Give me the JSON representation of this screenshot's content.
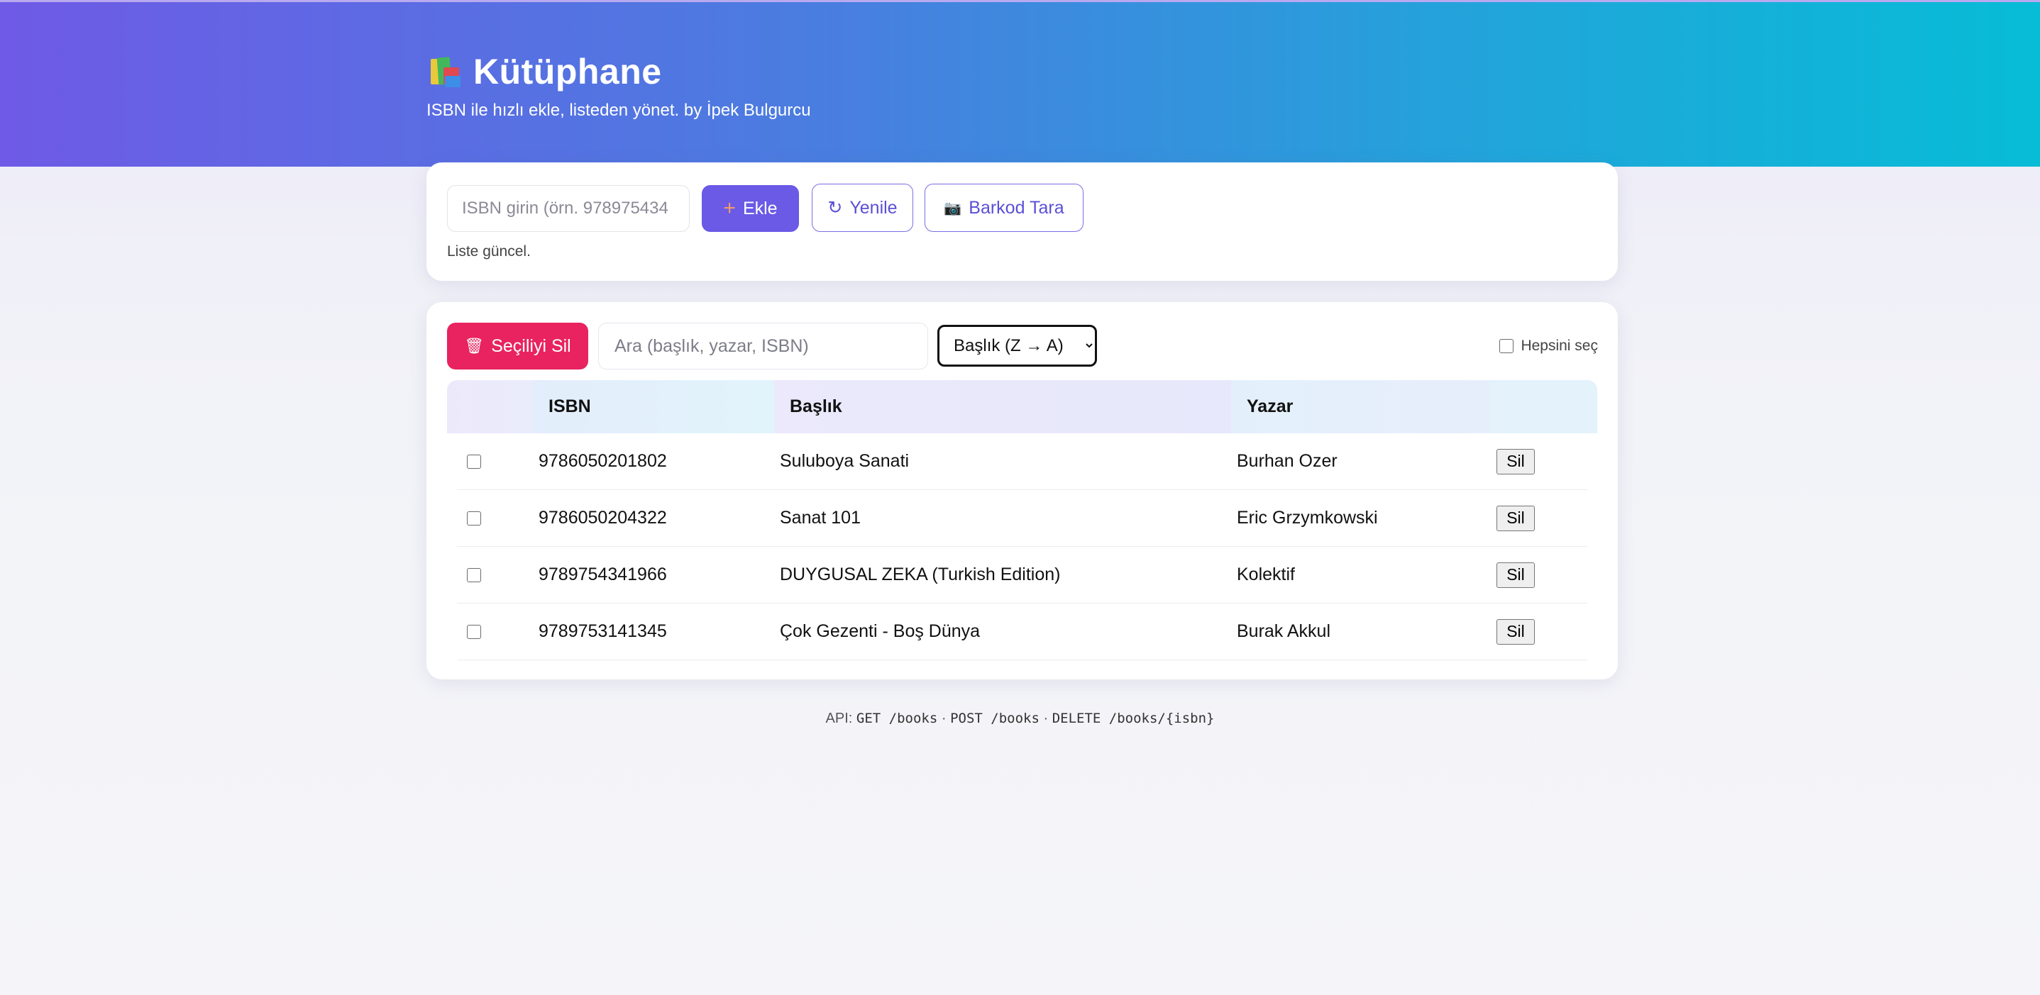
{
  "header": {
    "title": "Kütüphane",
    "subtitle": "ISBN ile hızlı ekle, listeden yönet. by İpek Bulgurcu",
    "gradient_start": "#6e5ae6",
    "gradient_end": "#07bcd6"
  },
  "add_panel": {
    "isbn_placeholder": "ISBN girin (örn. 978975434",
    "add_label": "Ekle",
    "refresh_label": "Yenile",
    "scan_label": "Barkod Tara",
    "status": "Liste güncel."
  },
  "list_panel": {
    "delete_selected_label": "Seçiliyi Sil",
    "search_placeholder": "Ara (başlık, yazar, ISBN)",
    "sort_selected": "Başlık (Z → A)",
    "select_all_label": "Hepsini seç",
    "columns": [
      "ISBN",
      "Başlık",
      "Yazar"
    ],
    "delete_row_label": "Sil",
    "rows": [
      {
        "isbn": "9786050201802",
        "title": "Suluboya Sanati",
        "author": "Burhan Ozer"
      },
      {
        "isbn": "9786050204322",
        "title": "Sanat 101",
        "author": "Eric Grzymkowski"
      },
      {
        "isbn": "9789754341966",
        "title": "DUYGUSAL ZEKA (Turkish Edition)",
        "author": "Kolektif"
      },
      {
        "isbn": "9789753141345",
        "title": "Çok Gezenti - Boş Dünya",
        "author": "Burak Akkul"
      }
    ]
  },
  "footer": {
    "api_prefix": "API:",
    "get": "GET /books",
    "post": "POST /books",
    "delete": "DELETE /books/{isbn}",
    "separator": "·"
  },
  "colors": {
    "accent": "#6a5ae6",
    "danger": "#e8235f"
  },
  "icons": {
    "brand": "books-icon",
    "add": "plus-icon",
    "refresh": "refresh-icon",
    "scan": "camera-icon",
    "delete_selected": "trash-icon"
  }
}
